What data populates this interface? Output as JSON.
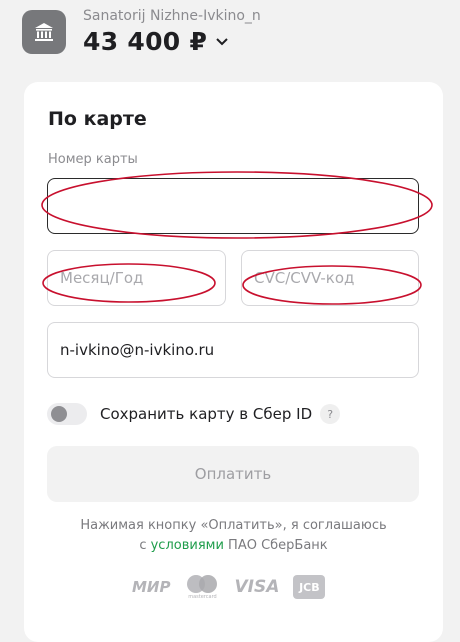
{
  "header": {
    "merchant_name": "Sanatorij Nizhne-Ivkino_n",
    "amount": "43 400 ₽"
  },
  "form": {
    "title": "По карте",
    "card_number_label": "Номер карты",
    "card_number_value": "",
    "expiry_placeholder": "Месяц/Год",
    "cvc_placeholder": "CVC/CVV-код",
    "email_value": "n-ivkino@n-ivkino.ru",
    "save_card_label": "Сохранить карту в Сбер ID",
    "save_card_enabled": false,
    "help_symbol": "?",
    "pay_button_label": "Оплатить"
  },
  "agreement": {
    "line1": "Нажимая кнопку «Оплатить», я соглашаюсь",
    "prefix": "с",
    "link_text": "условиями",
    "suffix": "ПАО СберБанк"
  },
  "payment_systems": {
    "mir": "МИР",
    "mastercard": "mastercard",
    "visa": "VISA",
    "jcb": "JCB"
  },
  "annotation_color": "#c8102e"
}
